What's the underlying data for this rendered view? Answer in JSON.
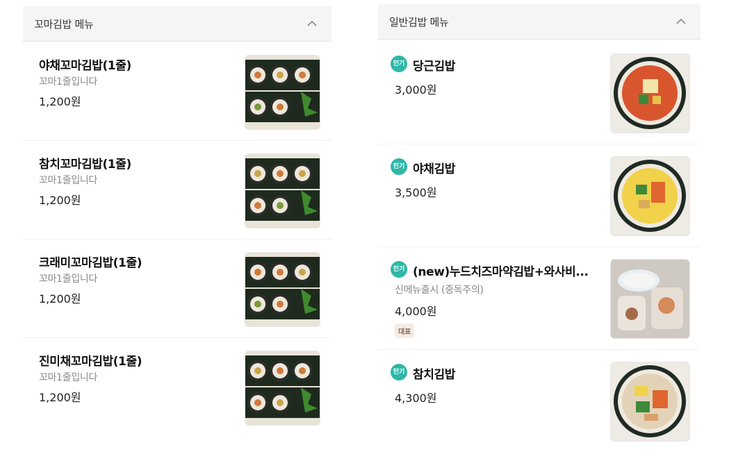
{
  "left_panel": {
    "title": "꼬마김밥 메뉴",
    "items": [
      {
        "name": "야채꼬마김밥(1줄)",
        "description": "꼬마1줄입니다",
        "price": "1,200원"
      },
      {
        "name": "참치꼬마김밥(1줄)",
        "description": "꼬마1줄입니다",
        "price": "1,200원"
      },
      {
        "name": "크래미꼬마김밥(1줄)",
        "description": "꼬마1줄입니다",
        "price": "1,200원"
      },
      {
        "name": "진미채꼬마김밥(1줄)",
        "description": "꼬마1줄입니다",
        "price": "1,200원"
      }
    ]
  },
  "right_panel": {
    "title": "일반김밥 메뉴",
    "popular_badge": "인기",
    "items": [
      {
        "name": "당근김밥",
        "price": "3,000원"
      },
      {
        "name": "야채김밥",
        "price": "3,500원"
      },
      {
        "name": "(new)누드치즈마약김밥+와사비...",
        "description": "신메뉴출시 (중독주의)",
        "price": "4,000원",
        "tag": "대표"
      },
      {
        "name": "참치김밥",
        "price": "4,300원"
      }
    ]
  },
  "icons": {
    "collapse": "chevron-up-icon"
  },
  "colors": {
    "badge": "#2fb7a7",
    "header_bg": "#f5f5f6",
    "tag_bg": "#f4ece6"
  }
}
